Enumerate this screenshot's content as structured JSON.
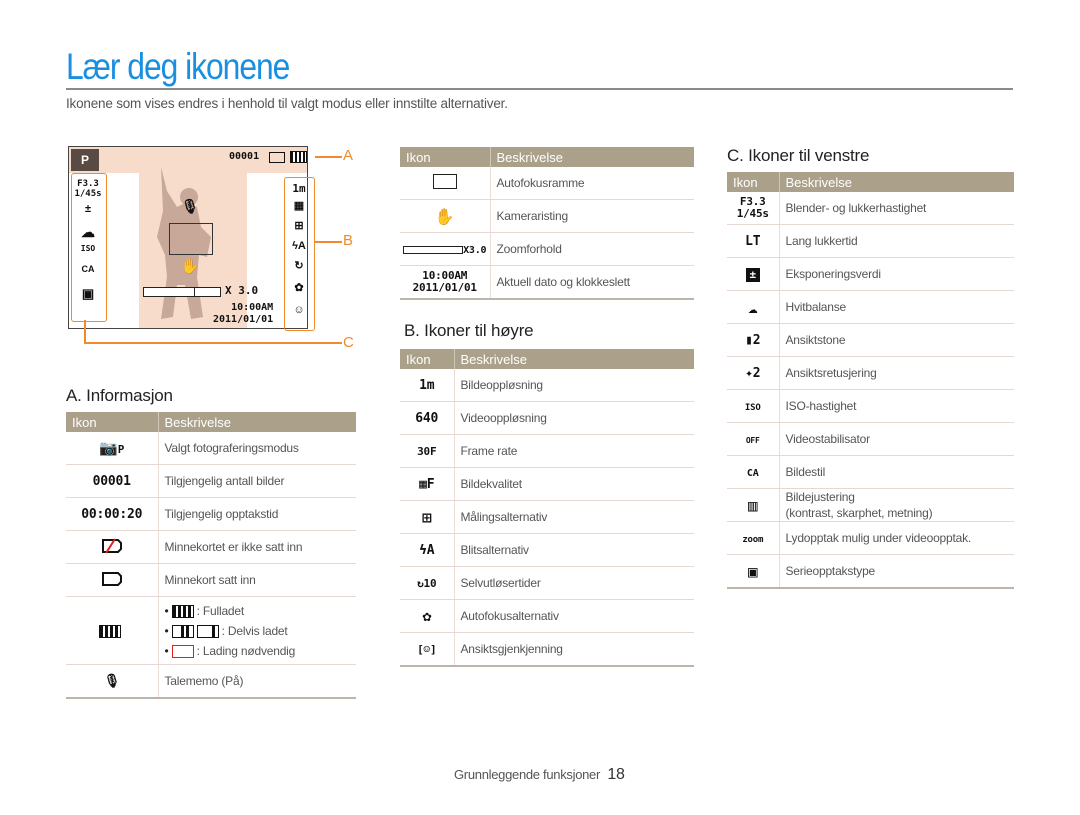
{
  "page": {
    "title": "Lær deg ikonene",
    "intro": "Ikonene som vises endres i henhold til valgt modus eller innstilte alternativer."
  },
  "camera_display": {
    "mode_icon": "camera-program-icon",
    "mode_label": "P",
    "shot_count": "00001",
    "aperture": "F3.3",
    "shutter": "1/45s",
    "iso": "ISO",
    "zoom": "X 3.0",
    "time": "10:00AM",
    "date": "2011/01/01",
    "resolution": "1m",
    "callouts": {
      "a": "A",
      "b": "B",
      "c": "C"
    },
    "colors": {
      "callout": "#f08a2a",
      "background": "#f7dccb"
    }
  },
  "headers": {
    "icon": "Ikon",
    "description": "Beskrivelse"
  },
  "section_a": {
    "heading": "A. Informasjon",
    "rows": [
      {
        "icon": "camera-mode-icon",
        "glyph": "📷P",
        "desc": "Valgt fotograferingsmodus"
      },
      {
        "icon": "shot-count-icon",
        "glyph": "00001",
        "desc": "Tilgjengelig antall bilder"
      },
      {
        "icon": "record-time-icon",
        "glyph": "00:00:20",
        "desc": "Tilgjengelig opptakstid"
      },
      {
        "icon": "no-card-icon",
        "glyph": "",
        "desc": "Minnekortet er ikke satt inn"
      },
      {
        "icon": "card-icon",
        "glyph": "",
        "desc": "Minnekort satt inn"
      },
      {
        "icon": "battery-icon",
        "glyph": "",
        "bullets": [
          ": Fulladet",
          ": Delvis ladet",
          ": Lading nødvendig"
        ]
      },
      {
        "icon": "voice-memo-icon",
        "glyph": "🎙",
        "desc": "Talememo (På)"
      }
    ]
  },
  "section_top_middle": {
    "rows": [
      {
        "icon": "af-frame-icon",
        "glyph": "",
        "desc": "Autofokusramme"
      },
      {
        "icon": "camera-shake-icon",
        "glyph": "✋",
        "desc": "Kameraristing"
      },
      {
        "icon": "zoom-ratio-icon",
        "glyph": "X3.0",
        "desc": "Zoomforhold"
      },
      {
        "icon": "date-time-icon",
        "glyph_line1": "10:00AM",
        "glyph_line2": "2011/01/01",
        "desc": "Aktuell dato og klokkeslett"
      }
    ]
  },
  "section_b": {
    "heading": "B. Ikoner til høyre",
    "rows": [
      {
        "icon": "photo-resolution-icon",
        "glyph": "1m",
        "desc": "Bildeoppløsning"
      },
      {
        "icon": "video-resolution-icon",
        "glyph": "640",
        "desc": "Videooppløsning"
      },
      {
        "icon": "frame-rate-icon",
        "glyph": "30F",
        "desc": "Frame rate"
      },
      {
        "icon": "image-quality-icon",
        "glyph": "▦F",
        "desc": "Bildekvalitet"
      },
      {
        "icon": "metering-icon",
        "glyph": "⊞",
        "desc": "Målingsalternativ"
      },
      {
        "icon": "flash-icon",
        "glyph": "ϟA",
        "desc": "Blitsalternativ"
      },
      {
        "icon": "self-timer-icon",
        "glyph": "↻10",
        "desc": "Selvutløsertider"
      },
      {
        "icon": "af-option-icon",
        "glyph": "✿",
        "desc": "Autofokusalternativ"
      },
      {
        "icon": "face-detect-icon",
        "glyph": "[☺]",
        "desc": "Ansiktsgjenkjenning"
      }
    ]
  },
  "section_c": {
    "heading": "C. Ikoner til venstre",
    "rows": [
      {
        "icon": "aperture-shutter-icon",
        "glyph_line1": "F3.3",
        "glyph_line2": "1/45s",
        "desc": "Blender- og lukkerhastighet"
      },
      {
        "icon": "long-shutter-icon",
        "glyph": "LT",
        "desc": "Lang lukkertid"
      },
      {
        "icon": "exposure-icon",
        "glyph": "±",
        "desc": "Eksponeringsverdi"
      },
      {
        "icon": "white-balance-icon",
        "glyph": "☁",
        "desc": "Hvitbalanse"
      },
      {
        "icon": "face-tone-icon",
        "glyph": "▮2",
        "desc": "Ansiktstone"
      },
      {
        "icon": "face-retouch-icon",
        "glyph": "✦2",
        "desc": "Ansiktsretusjering"
      },
      {
        "icon": "iso-icon",
        "glyph": "ISO",
        "desc": "ISO-hastighet"
      },
      {
        "icon": "video-stabilizer-icon",
        "glyph": "OFF",
        "desc": "Videostabilisator"
      },
      {
        "icon": "photo-style-icon",
        "glyph": "CA",
        "desc": "Bildestil"
      },
      {
        "icon": "image-adjust-icon",
        "glyph": "▥",
        "desc": "Bildejustering",
        "desc2": "(kontrast, skarphet, metning)"
      },
      {
        "icon": "zoom-sound-icon",
        "glyph": "zoom",
        "desc": "Lydopptak mulig under videoopptak."
      },
      {
        "icon": "burst-mode-icon",
        "glyph": "▣",
        "desc": "Serieopptakstype"
      }
    ]
  },
  "footer": {
    "section": "Grunnleggende funksjoner",
    "page_number": "18"
  }
}
